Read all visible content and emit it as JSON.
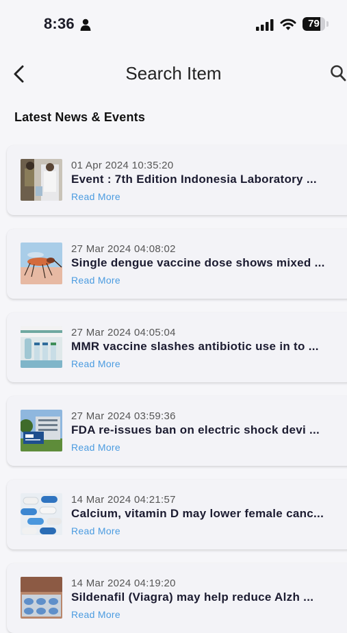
{
  "status_bar": {
    "time": "8:36",
    "battery": "79",
    "battery_level": 0.79
  },
  "header": {
    "title": "Search Item"
  },
  "section": {
    "title": "Latest News & Events"
  },
  "news": [
    {
      "date": "01 Apr 2024 10:35:20",
      "headline": "Event : 7th Edition Indonesia Laboratory ...",
      "link": "Read More",
      "thumb": "lab-event"
    },
    {
      "date": "27 Mar 2024 04:08:02",
      "headline": "Single dengue vaccine dose shows mixed ...",
      "link": "Read More",
      "thumb": "mosquito"
    },
    {
      "date": "27 Mar 2024 04:05:04",
      "headline": "MMR vaccine slashes antibiotic use in to ...",
      "link": "Read More",
      "thumb": "vaccine-vials"
    },
    {
      "date": "27 Mar 2024 03:59:36",
      "headline": "FDA re-issues ban on electric shock devi ...",
      "link": "Read More",
      "thumb": "fda-building"
    },
    {
      "date": "14 Mar 2024 04:21:57",
      "headline": "Calcium, vitamin D may lower female canc...",
      "link": "Read More",
      "thumb": "pills"
    },
    {
      "date": "14 Mar 2024 04:19:20",
      "headline": "Sildenafil (Viagra) may help reduce Alzh ...",
      "link": "Read More",
      "thumb": "blister-pack"
    }
  ]
}
